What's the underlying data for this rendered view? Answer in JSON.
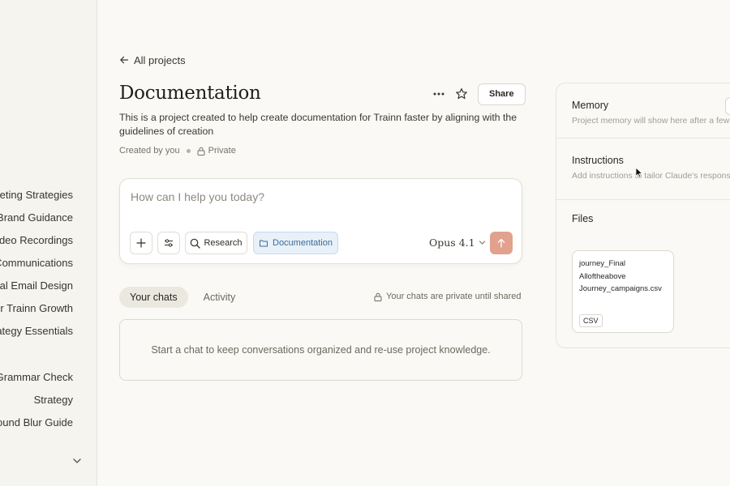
{
  "sidebar": {
    "items": [
      {
        "label": "Marketing Strategies"
      },
      {
        "label": "Brand Guidance"
      },
      {
        "label": "Trainn Video Recordings"
      },
      {
        "label": "Email Communications"
      },
      {
        "label": "Tutorial Email Design"
      },
      {
        "label": "Strategy for Trainn Growth"
      },
      {
        "label": "Strategy Essentials"
      },
      {
        "label": "Grammar Check"
      },
      {
        "label": "Strategy"
      },
      {
        "label": "Background Blur Guide"
      }
    ]
  },
  "header": {
    "back_label": "All projects",
    "title": "Documentation",
    "share_label": "Share"
  },
  "project": {
    "description": "This is a project created to help create documentation for Trainn faster by aligning with the guidelines of creation",
    "created_by": "Created by you",
    "visibility": "Private"
  },
  "composer": {
    "placeholder": "How can I help you today?",
    "research_label": "Research",
    "project_chip": "Documentation",
    "model": "Opus 4.1"
  },
  "tabs": [
    {
      "label": "Your chats",
      "active": true
    },
    {
      "label": "Activity",
      "active": false
    }
  ],
  "privacy_note": "Your chats are private until shared",
  "empty_state": "Start a chat to keep conversations organized and re-use project knowledge.",
  "panel": {
    "memory_title": "Memory",
    "memory_sub": "Project memory will show here after a few chats.",
    "instructions_title": "Instructions",
    "instructions_sub": "Add instructions to tailor Claude's responses",
    "files_title": "Files",
    "file": {
      "name_lines": [
        "journey_Final",
        "Alloftheabove",
        "Journey_campaigns.csv"
      ],
      "type": "CSV"
    }
  },
  "colors": {
    "background": "#faf9f5",
    "send_button": "#e2a18d",
    "project_chip_bg": "#e8f0f8",
    "project_chip_text": "#3a6d9a"
  }
}
